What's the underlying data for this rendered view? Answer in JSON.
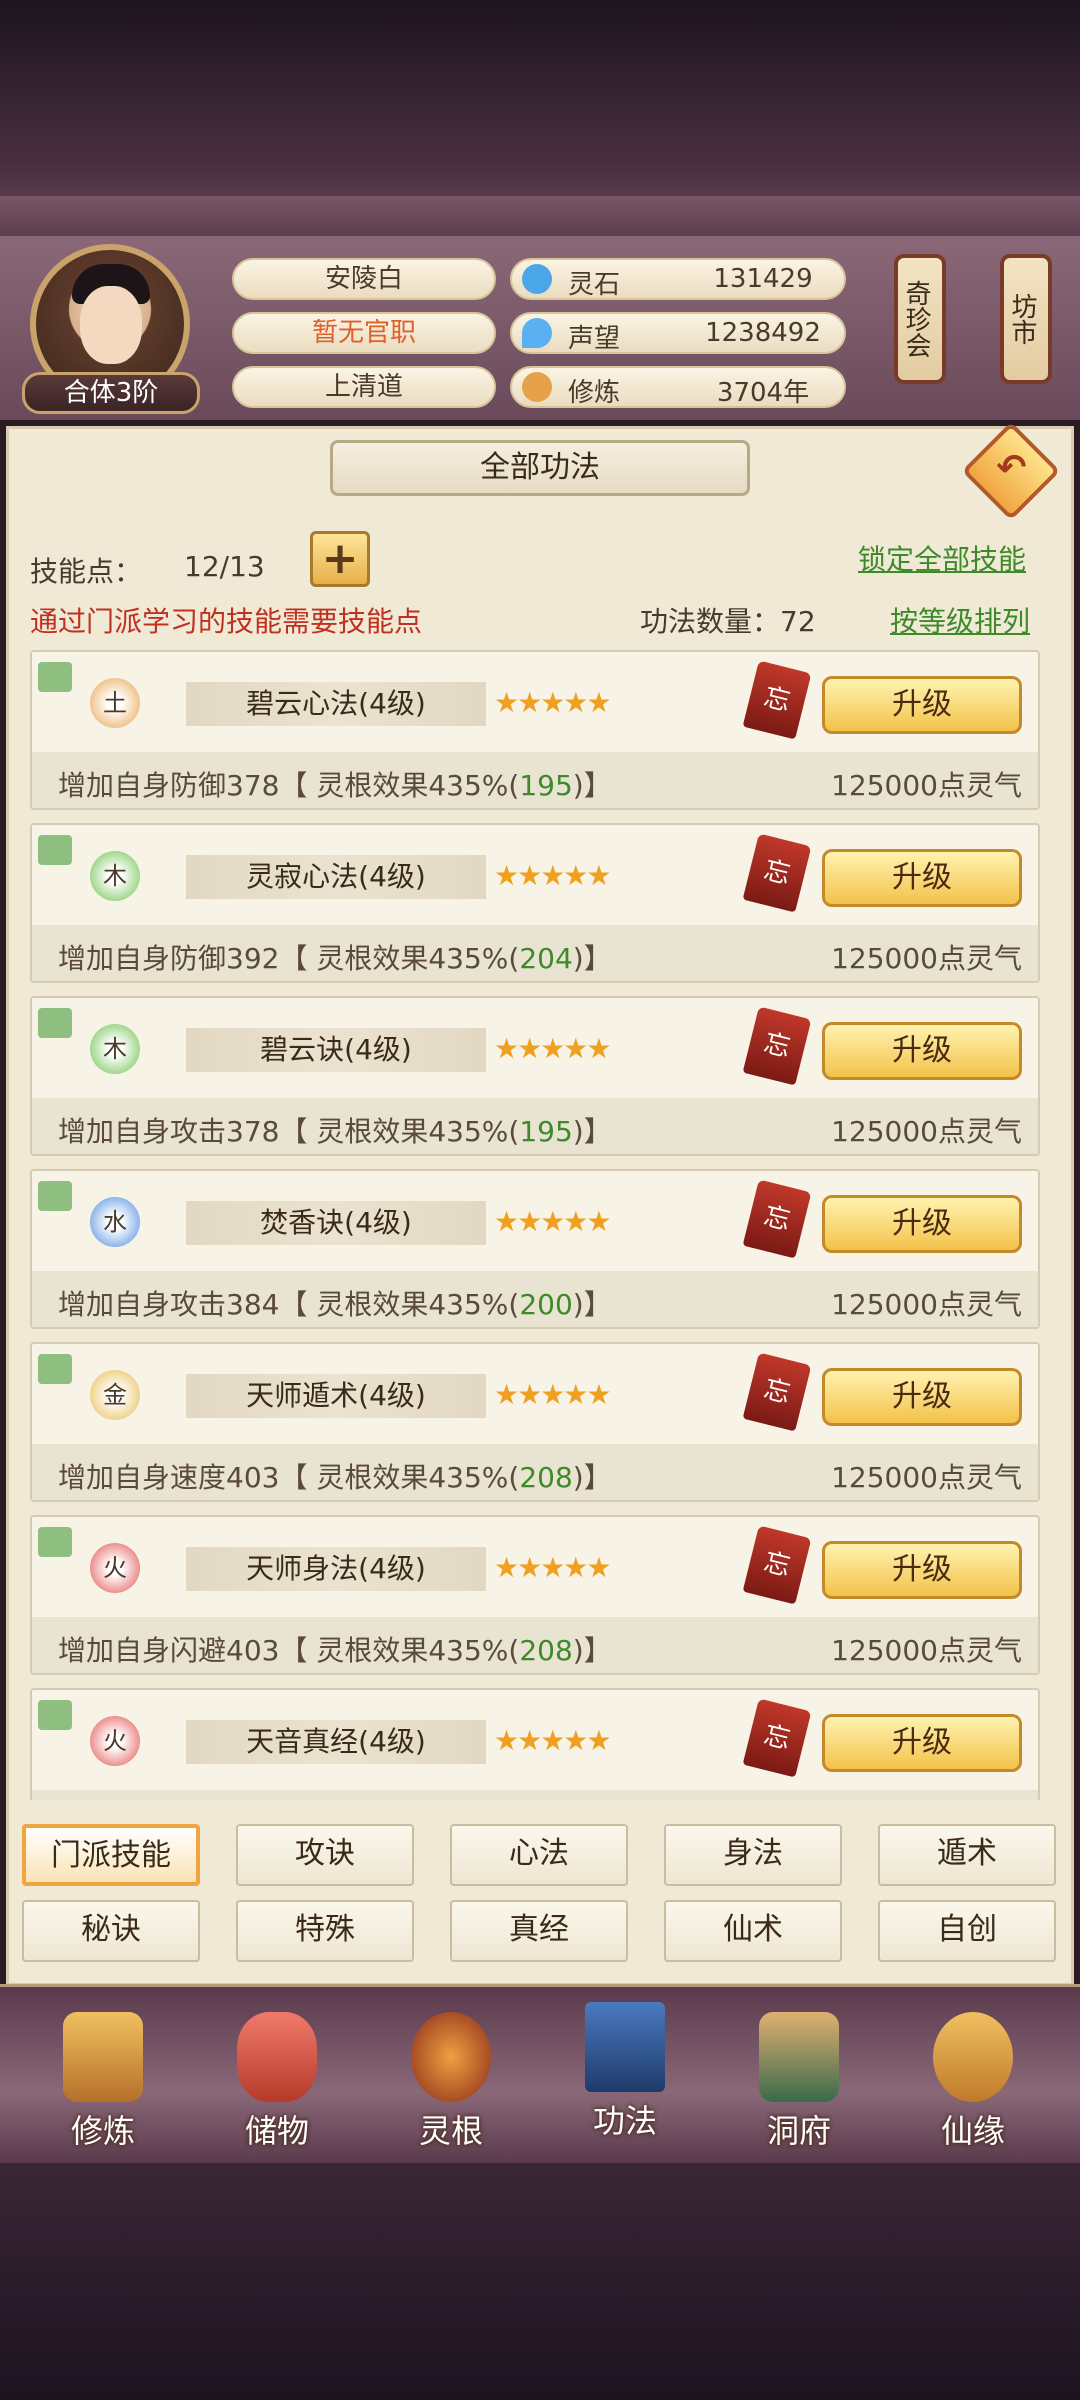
{
  "player": {
    "name": "安陵白",
    "title": "暂无官职",
    "sect": "上清道",
    "rank": "合体3阶"
  },
  "stats": [
    {
      "icon": "spirit-stone-icon",
      "label": "灵石",
      "value": "131429"
    },
    {
      "icon": "reputation-icon",
      "label": "声望",
      "value": "1238492"
    },
    {
      "icon": "cultivation-icon",
      "label": "修炼",
      "value": "3704年"
    }
  ],
  "side_tags": {
    "treasure": "奇珍会",
    "market": "坊市"
  },
  "panel": {
    "title": "全部功法",
    "skill_points_label": "技能点：",
    "skill_points_value": "12/13",
    "note": "通过门派学习的技能需要技能点",
    "lock_all": "锁定全部技能",
    "count_label": "功法数量：72",
    "sort_label": "按等级排列",
    "upgrade_label": "升级",
    "forget_label": "忘",
    "stars": "★★★★★"
  },
  "skills": [
    {
      "element": "土",
      "element_color": "#e6a24a",
      "name": "碧云心法(4级)",
      "effect_pre": "增加自身防御378【 灵根效果435%(",
      "bonus": "195",
      "effect_post": ")】",
      "cost": "125000点灵气"
    },
    {
      "element": "木",
      "element_color": "#6cbf4a",
      "name": "灵寂心法(4级)",
      "effect_pre": "增加自身防御392【 灵根效果435%(",
      "bonus": "204",
      "effect_post": ")】",
      "cost": "125000点灵气"
    },
    {
      "element": "木",
      "element_color": "#6cbf4a",
      "name": "碧云诀(4级)",
      "effect_pre": "增加自身攻击378【 灵根效果435%(",
      "bonus": "195",
      "effect_post": ")】",
      "cost": "125000点灵气"
    },
    {
      "element": "水",
      "element_color": "#4a8ae0",
      "name": "焚香诀(4级)",
      "effect_pre": "增加自身攻击384【 灵根效果435%(",
      "bonus": "200",
      "effect_post": ")】",
      "cost": "125000点灵气"
    },
    {
      "element": "金",
      "element_color": "#e6b84a",
      "name": "天师遁术(4级)",
      "effect_pre": "增加自身速度403【 灵根效果435%(",
      "bonus": "208",
      "effect_post": ")】",
      "cost": "125000点灵气"
    },
    {
      "element": "火",
      "element_color": "#e0504a",
      "name": "天师身法(4级)",
      "effect_pre": "增加自身闪避403【 灵根效果435%(",
      "bonus": "208",
      "effect_post": ")】",
      "cost": "125000点灵气"
    },
    {
      "element": "火",
      "element_color": "#e0504a",
      "name": "天音真经(4级)",
      "effect_pre": "",
      "bonus": "",
      "effect_post": "",
      "cost": ""
    }
  ],
  "tabs": [
    "门派技能",
    "攻诀",
    "心法",
    "身法",
    "遁术",
    "秘诀",
    "特殊",
    "真经",
    "仙术",
    "自创"
  ],
  "nav": [
    "修炼",
    "储物",
    "灵根",
    "功法",
    "洞府",
    "仙缘"
  ]
}
